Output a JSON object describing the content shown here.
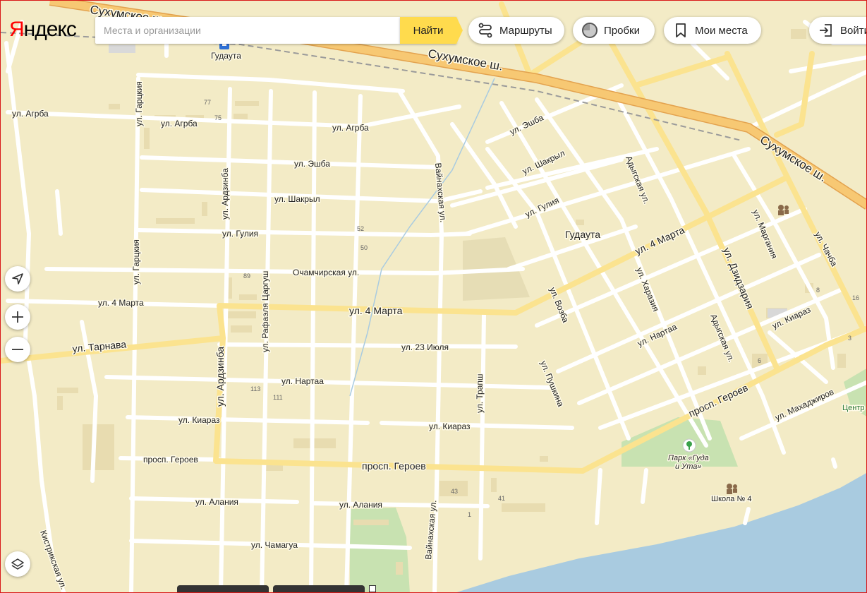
{
  "header": {
    "logo_y": "Я",
    "logo_rest": "ндекс",
    "search_placeholder": "Места и организации",
    "search_value": "",
    "find_label": "Найти",
    "routes_label": "Маршруты",
    "traffic_label": "Пробки",
    "mymaps_label": "Мои места",
    "login_label": "Войти"
  },
  "map": {
    "city_label": "Гудаута",
    "station_label": "Гудаута",
    "highway_label_1": "Сухумское ш.",
    "highway_label_2": "Сухумское ш.",
    "highway_label_3": "Сухумское ш.",
    "streets": {
      "agrba_1": "ул. Агрба",
      "agrba_2": "ул. Агрба",
      "agrba_3": "ул. Агрба",
      "eshba_1": "ул. Эшба",
      "eshba_2": "ул. Эшба",
      "shakryl_1": "ул. Шакрыл",
      "shakryl_2": "ул. Шакрыл",
      "guliya_1": "ул. Гулия",
      "guliya_2": "ул. Гулия",
      "ochamchirskaya": "Очамчирская ул.",
      "marta_1": "ул. 4 Марта",
      "marta_2": "ул. 4 Марта",
      "marta_3": "ул. 4 Марта",
      "tarnava": "ул. Тарнава",
      "iyulya": "ул. 23 Июля",
      "nartaa_1": "ул. Нартаа",
      "nartaa_2": "ул. Нартаа",
      "kiaraz_1": "ул. Киараз",
      "kiaraz_2": "ул. Киараз",
      "kiaraz_3": "ул. Киараз",
      "geroev_1": "просп. Героев",
      "geroev_2": "просп. Героев",
      "geroev_3": "просп. Героев",
      "alaniya_1": "ул. Алания",
      "alaniya_2": "ул. Алания",
      "chamagua": "ул. Чамагуа",
      "garckiya_1": "ул. Гарцкия",
      "garckiya_2": "ул. Гарцкия",
      "ardzinba_1": "ул. Ардзинба",
      "ardzinba_2": "ул. Ардзинба",
      "rafael": "ул. Рафаэля Царгуш",
      "vaynakh_1": "Вайнахская ул.",
      "vaynakh_2": "Вайнахская ул.",
      "trapsh": "ул. Трапш",
      "pushkina": "ул. Пушкина",
      "vozba": "ул. Возба",
      "adygskaya_1": "Адыгская ул.",
      "adygskaya_2": "Адыгская ул.",
      "kharaziya": "ул. Харазия",
      "dzidzariya": "ул. Дзидзария",
      "margania": "ул. Маргания",
      "chachba": "ул. Чачба",
      "makhadzhirov": "ул. Махаджиров",
      "kistrikskaya": "Кистрикская ул."
    },
    "park_label": "Парк «Гуда и Ута»",
    "park_line_1": "Парк «Гуда",
    "park_line_2": "и Ута»",
    "school_label": "Школа № 4",
    "center_label": "Центр",
    "house_numbers": [
      "77",
      "75",
      "52",
      "50",
      "89",
      "113",
      "111",
      "43",
      "41",
      "1",
      "8",
      "16",
      "6",
      "3"
    ]
  },
  "colors": {
    "land": "#f3ebc6",
    "road": "#ffffff",
    "major_road": "#fbe38f",
    "highway": "#f7c873",
    "sea": "#a9cbe0",
    "park": "#c8e2b1",
    "accent_yellow": "#ffdb4d",
    "logo_red": "#ff0000"
  }
}
